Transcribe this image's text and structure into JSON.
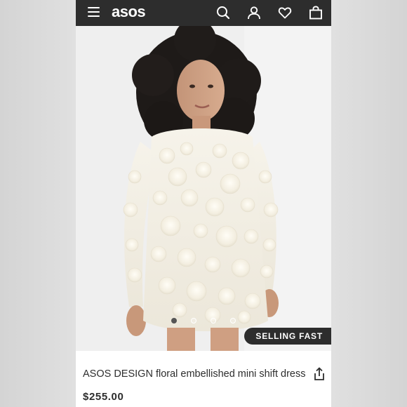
{
  "header": {
    "logo": "asos",
    "icons": [
      "menu-icon",
      "search-icon",
      "account-icon",
      "heart-icon",
      "bag-icon"
    ]
  },
  "gallery": {
    "image_count": 4,
    "active_index": 0,
    "badge": "SELLING FAST"
  },
  "product": {
    "title": "ASOS DESIGN floral embellished mini shift dress",
    "price": "$255.00"
  },
  "colors": {
    "topbar": "#2d2d2d",
    "text": "#2d2d2d",
    "badge_bg": "#2d2d2d"
  }
}
